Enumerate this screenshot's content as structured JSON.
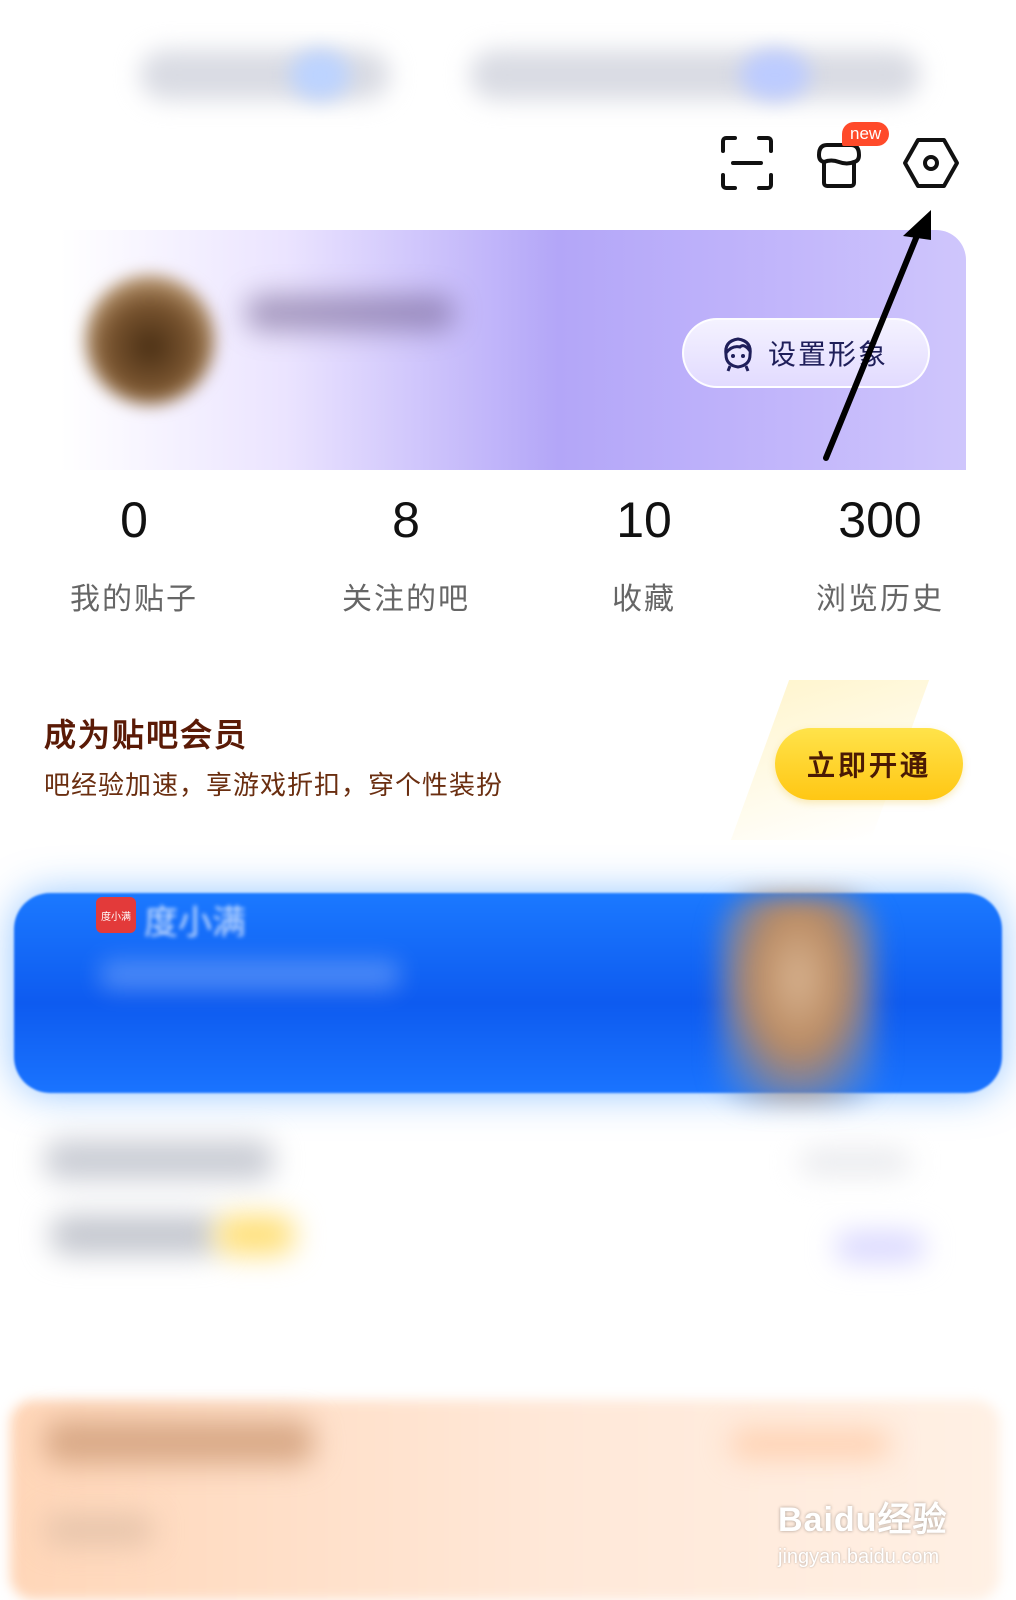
{
  "top_icons": {
    "scan": "scan-icon",
    "shop": "shop-icon",
    "shop_badge": "new",
    "settings": "settings-icon"
  },
  "profile": {
    "set_avatar_label": "设置形象"
  },
  "stats": [
    {
      "value": "0",
      "label": "我的贴子"
    },
    {
      "value": "8",
      "label": "关注的吧"
    },
    {
      "value": "10",
      "label": "收藏"
    },
    {
      "value": "300",
      "label": "浏览历史"
    }
  ],
  "membership": {
    "title": "成为贴吧会员",
    "subtitle": "吧经验加速，享游戏折扣，穿个性装扮",
    "cta": "立即开通"
  },
  "ad_banner": {
    "logo_text": "度小满",
    "brand": "度小满"
  },
  "watermark": {
    "main": "Baidu经验",
    "sub": "jingyan.baidu.com"
  },
  "colors": {
    "accent_purple": "#b3a6f8",
    "member_button": "#ffc714",
    "member_text": "#5a1a06",
    "ad_blue": "#0e5bf0",
    "badge_red": "#ff4a2a"
  }
}
